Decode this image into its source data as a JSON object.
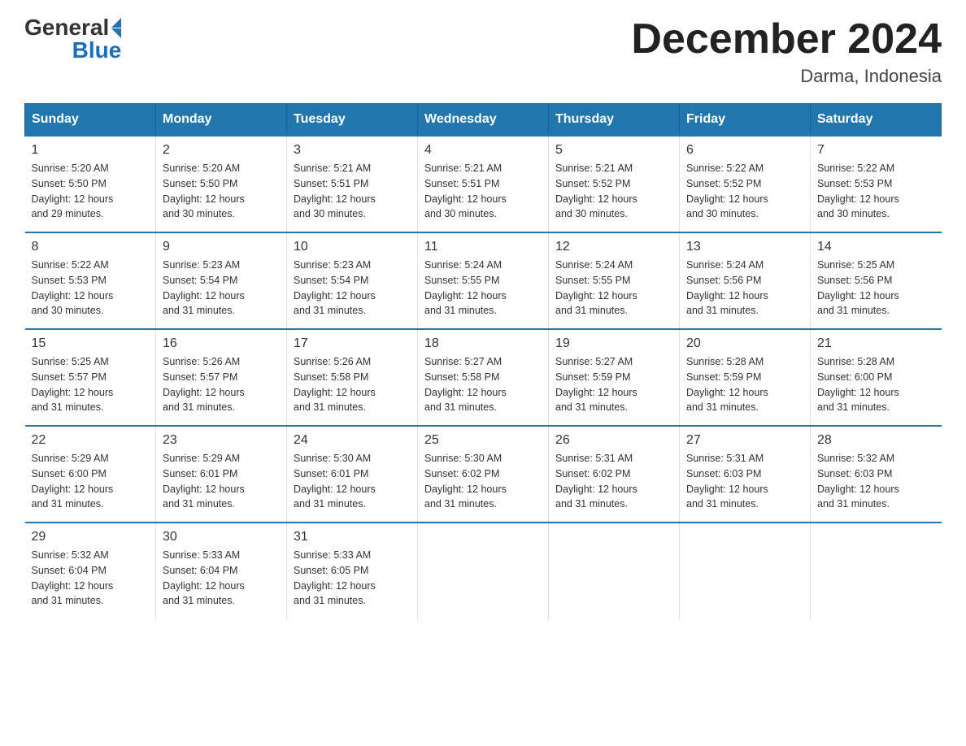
{
  "logo": {
    "text_general": "General",
    "text_blue": "Blue"
  },
  "title": "December 2024",
  "subtitle": "Darma, Indonesia",
  "days_of_week": [
    "Sunday",
    "Monday",
    "Tuesday",
    "Wednesday",
    "Thursday",
    "Friday",
    "Saturday"
  ],
  "weeks": [
    [
      {
        "day": "1",
        "sunrise": "5:20 AM",
        "sunset": "5:50 PM",
        "daylight": "12 hours and 29 minutes."
      },
      {
        "day": "2",
        "sunrise": "5:20 AM",
        "sunset": "5:50 PM",
        "daylight": "12 hours and 30 minutes."
      },
      {
        "day": "3",
        "sunrise": "5:21 AM",
        "sunset": "5:51 PM",
        "daylight": "12 hours and 30 minutes."
      },
      {
        "day": "4",
        "sunrise": "5:21 AM",
        "sunset": "5:51 PM",
        "daylight": "12 hours and 30 minutes."
      },
      {
        "day": "5",
        "sunrise": "5:21 AM",
        "sunset": "5:52 PM",
        "daylight": "12 hours and 30 minutes."
      },
      {
        "day": "6",
        "sunrise": "5:22 AM",
        "sunset": "5:52 PM",
        "daylight": "12 hours and 30 minutes."
      },
      {
        "day": "7",
        "sunrise": "5:22 AM",
        "sunset": "5:53 PM",
        "daylight": "12 hours and 30 minutes."
      }
    ],
    [
      {
        "day": "8",
        "sunrise": "5:22 AM",
        "sunset": "5:53 PM",
        "daylight": "12 hours and 30 minutes."
      },
      {
        "day": "9",
        "sunrise": "5:23 AM",
        "sunset": "5:54 PM",
        "daylight": "12 hours and 31 minutes."
      },
      {
        "day": "10",
        "sunrise": "5:23 AM",
        "sunset": "5:54 PM",
        "daylight": "12 hours and 31 minutes."
      },
      {
        "day": "11",
        "sunrise": "5:24 AM",
        "sunset": "5:55 PM",
        "daylight": "12 hours and 31 minutes."
      },
      {
        "day": "12",
        "sunrise": "5:24 AM",
        "sunset": "5:55 PM",
        "daylight": "12 hours and 31 minutes."
      },
      {
        "day": "13",
        "sunrise": "5:24 AM",
        "sunset": "5:56 PM",
        "daylight": "12 hours and 31 minutes."
      },
      {
        "day": "14",
        "sunrise": "5:25 AM",
        "sunset": "5:56 PM",
        "daylight": "12 hours and 31 minutes."
      }
    ],
    [
      {
        "day": "15",
        "sunrise": "5:25 AM",
        "sunset": "5:57 PM",
        "daylight": "12 hours and 31 minutes."
      },
      {
        "day": "16",
        "sunrise": "5:26 AM",
        "sunset": "5:57 PM",
        "daylight": "12 hours and 31 minutes."
      },
      {
        "day": "17",
        "sunrise": "5:26 AM",
        "sunset": "5:58 PM",
        "daylight": "12 hours and 31 minutes."
      },
      {
        "day": "18",
        "sunrise": "5:27 AM",
        "sunset": "5:58 PM",
        "daylight": "12 hours and 31 minutes."
      },
      {
        "day": "19",
        "sunrise": "5:27 AM",
        "sunset": "5:59 PM",
        "daylight": "12 hours and 31 minutes."
      },
      {
        "day": "20",
        "sunrise": "5:28 AM",
        "sunset": "5:59 PM",
        "daylight": "12 hours and 31 minutes."
      },
      {
        "day": "21",
        "sunrise": "5:28 AM",
        "sunset": "6:00 PM",
        "daylight": "12 hours and 31 minutes."
      }
    ],
    [
      {
        "day": "22",
        "sunrise": "5:29 AM",
        "sunset": "6:00 PM",
        "daylight": "12 hours and 31 minutes."
      },
      {
        "day": "23",
        "sunrise": "5:29 AM",
        "sunset": "6:01 PM",
        "daylight": "12 hours and 31 minutes."
      },
      {
        "day": "24",
        "sunrise": "5:30 AM",
        "sunset": "6:01 PM",
        "daylight": "12 hours and 31 minutes."
      },
      {
        "day": "25",
        "sunrise": "5:30 AM",
        "sunset": "6:02 PM",
        "daylight": "12 hours and 31 minutes."
      },
      {
        "day": "26",
        "sunrise": "5:31 AM",
        "sunset": "6:02 PM",
        "daylight": "12 hours and 31 minutes."
      },
      {
        "day": "27",
        "sunrise": "5:31 AM",
        "sunset": "6:03 PM",
        "daylight": "12 hours and 31 minutes."
      },
      {
        "day": "28",
        "sunrise": "5:32 AM",
        "sunset": "6:03 PM",
        "daylight": "12 hours and 31 minutes."
      }
    ],
    [
      {
        "day": "29",
        "sunrise": "5:32 AM",
        "sunset": "6:04 PM",
        "daylight": "12 hours and 31 minutes."
      },
      {
        "day": "30",
        "sunrise": "5:33 AM",
        "sunset": "6:04 PM",
        "daylight": "12 hours and 31 minutes."
      },
      {
        "day": "31",
        "sunrise": "5:33 AM",
        "sunset": "6:05 PM",
        "daylight": "12 hours and 31 minutes."
      },
      {
        "day": "",
        "sunrise": "",
        "sunset": "",
        "daylight": ""
      },
      {
        "day": "",
        "sunrise": "",
        "sunset": "",
        "daylight": ""
      },
      {
        "day": "",
        "sunrise": "",
        "sunset": "",
        "daylight": ""
      },
      {
        "day": "",
        "sunrise": "",
        "sunset": "",
        "daylight": ""
      }
    ]
  ],
  "labels": {
    "sunrise_prefix": "Sunrise: ",
    "sunset_prefix": "Sunset: ",
    "daylight_prefix": "Daylight: "
  }
}
